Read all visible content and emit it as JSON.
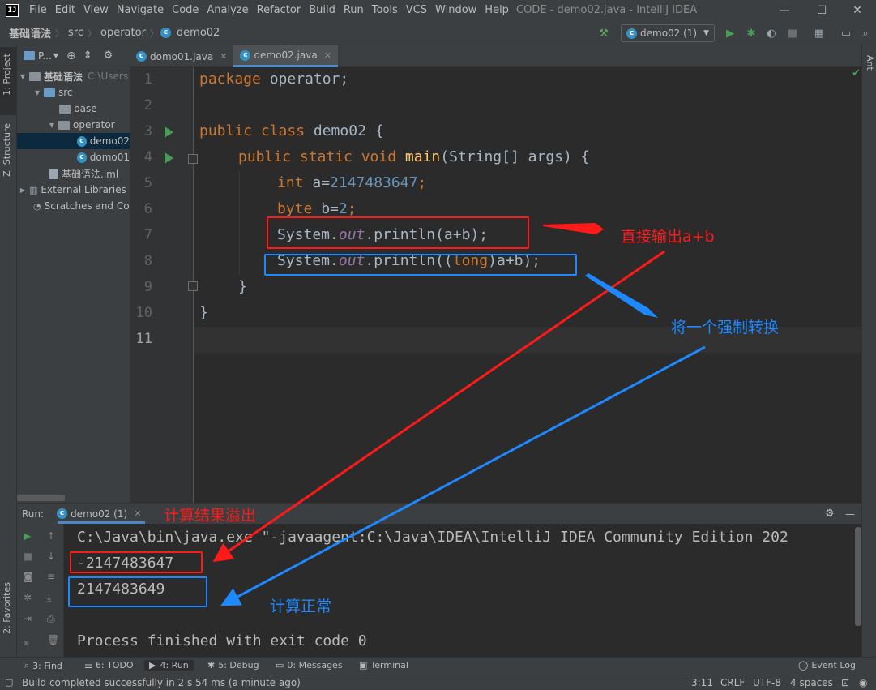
{
  "window": {
    "title": "CODE - demo02.java - IntelliJ IDEA",
    "menu": [
      "File",
      "Edit",
      "View",
      "Navigate",
      "Code",
      "Analyze",
      "Refactor",
      "Build",
      "Run",
      "Tools",
      "VCS",
      "Window",
      "Help"
    ]
  },
  "breadcrumb": [
    "基础语法",
    "src",
    "operator",
    "demo02"
  ],
  "run_config": "demo02 (1)",
  "left_stripe": {
    "project": "1: Project",
    "structure": "Z: Structure",
    "favorites": "2: Favorites"
  },
  "right_stripe": {
    "ant": "Ant"
  },
  "project_panel": {
    "header": "P...",
    "tree": [
      {
        "label": "基础语法",
        "hint": "C:\\Users"
      },
      {
        "label": "src"
      },
      {
        "label": "base"
      },
      {
        "label": "operator"
      },
      {
        "label": "demo02"
      },
      {
        "label": "domo01"
      },
      {
        "label": "基础语法.iml"
      },
      {
        "label": "External Libraries"
      },
      {
        "label": "Scratches and Co"
      }
    ]
  },
  "editor_tabs": [
    {
      "label": "domo01.java",
      "active": false
    },
    {
      "label": "demo02.java",
      "active": true
    }
  ],
  "code": {
    "line_numbers": [
      "1",
      "2",
      "3",
      "4",
      "5",
      "6",
      "7",
      "8",
      "9",
      "10",
      "11"
    ],
    "l1_kw": "package",
    "l1_rest": " operator;",
    "l3_kw": "public class",
    "l3_rest": " demo02 {",
    "l4_kw": "public static void",
    "l4_fn": "main",
    "l4_rest": "(String[] args) {",
    "l5_kw": "int",
    "l5_a": " a=",
    "l5_num": "2147483647",
    "l5_end": ";",
    "l6_kw": "byte",
    "l6_b": " b=",
    "l6_num": "2",
    "l6_end": ";",
    "l7_pre": "System.",
    "l7_out": "out",
    "l7_post": ".println(a+b);",
    "l8_pre": "System.",
    "l8_out": "out",
    "l8_mid": ".println((",
    "l8_kw": "long",
    "l8_post": ")a+b);",
    "l9": "}",
    "l10": "}"
  },
  "run_panel": {
    "label": "Run:",
    "tab": "demo02 (1)",
    "console": [
      "C:\\Java\\bin\\java.exe \"-javaagent:C:\\Java\\IDEA\\IntelliJ IDEA Community Edition 202",
      "-2147483647",
      "2147483649",
      "",
      "Process finished with exit code 0"
    ]
  },
  "bottom_tools": [
    "3: Find",
    "6: TODO",
    "4: Run",
    "5: Debug",
    "0: Messages",
    "Terminal",
    "Event Log"
  ],
  "status": {
    "message": "Build completed successfully in 2 s 54 ms (a minute ago)",
    "position": "3:11",
    "line_sep": "CRLF",
    "encoding": "UTF-8",
    "indent": "4 spaces"
  },
  "annotations": {
    "direct_output": "直接输出a+b",
    "cast": "将一个强制转换",
    "overflow": "计算结果溢出",
    "normal": "计算正常"
  },
  "colors": {
    "red": "#ff1a1a",
    "blue": "#1e88ff",
    "keyword": "#cc7832",
    "number": "#6897bb"
  }
}
